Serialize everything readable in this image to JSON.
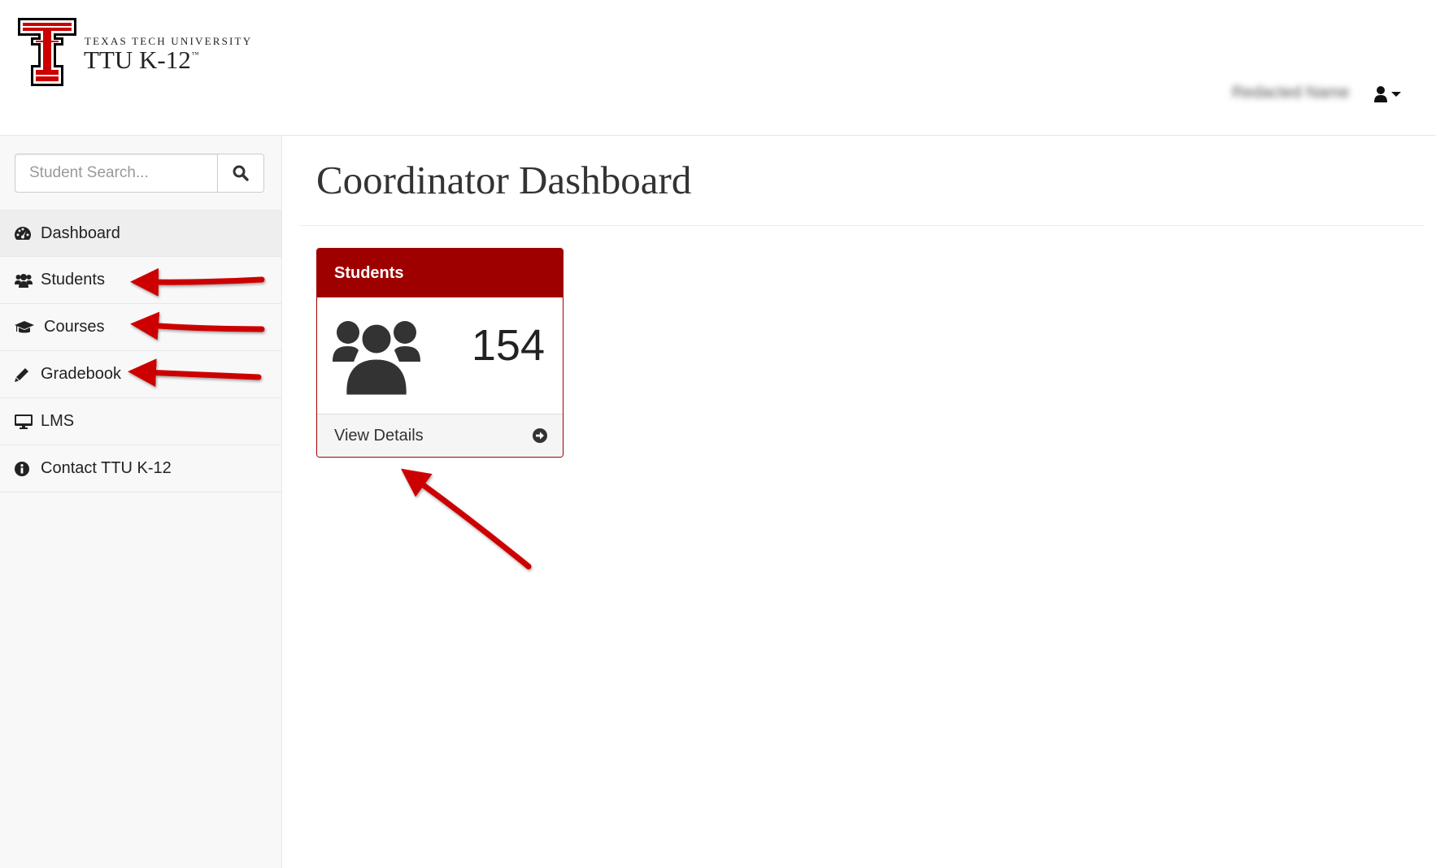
{
  "brand": {
    "university": "TEXAS TECH UNIVERSITY",
    "product": "TTU K-12",
    "trademark": "™",
    "logo_icon": "double-t-logo-icon",
    "logo_color": "#cc0000"
  },
  "header": {
    "user_name": "Redacted Name",
    "user_icon": "user-icon",
    "caret_icon": "caret-down-icon"
  },
  "sidebar": {
    "search": {
      "placeholder": "Student Search...",
      "value": "",
      "icon": "search-icon"
    },
    "items": [
      {
        "label": "Dashboard",
        "icon": "tachometer-icon",
        "active": true
      },
      {
        "label": "Students",
        "icon": "users-icon",
        "active": false
      },
      {
        "label": "Courses",
        "icon": "graduation-cap-icon",
        "active": false
      },
      {
        "label": "Gradebook",
        "icon": "pencil-icon",
        "active": false
      },
      {
        "label": "LMS",
        "icon": "desktop-icon",
        "active": false
      },
      {
        "label": "Contact TTU K-12",
        "icon": "info-circle-icon",
        "active": false
      }
    ]
  },
  "main": {
    "title": "Coordinator Dashboard",
    "panel": {
      "heading": "Students",
      "count": "154",
      "footer_label": "View Details",
      "icon": "users-icon",
      "footer_icon": "arrow-circle-right-icon"
    }
  },
  "colors": {
    "accent": "#9e0000",
    "annotation_arrow": "#cc0000",
    "sidebar_bg": "#f8f8f8"
  }
}
